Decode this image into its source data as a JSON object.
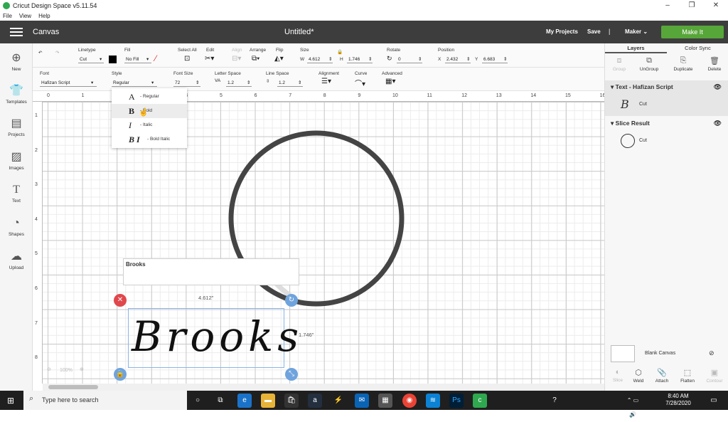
{
  "window": {
    "title": "Cricut Design Space  v5.11.54",
    "menu": [
      "File",
      "View",
      "Help"
    ]
  },
  "header": {
    "section": "Canvas",
    "doc_title": "Untitled*",
    "my_projects": "My Projects",
    "save": "Save",
    "separator": "|",
    "machine": "Maker",
    "make_it": "Make It"
  },
  "leftbar": {
    "items": [
      {
        "label": "New",
        "icon": "plus-circle-icon"
      },
      {
        "label": "Templates",
        "icon": "shirt-icon"
      },
      {
        "label": "Projects",
        "icon": "projects-icon"
      },
      {
        "label": "Images",
        "icon": "image-icon"
      },
      {
        "label": "Text",
        "icon": "text-icon"
      },
      {
        "label": "Shapes",
        "icon": "shapes-icon"
      },
      {
        "label": "Upload",
        "icon": "upload-icon"
      }
    ]
  },
  "toolbar1": {
    "linetype_label": "Linetype",
    "linetype_value": "Cut",
    "fill_label": "Fill",
    "fill_value": "No Fill",
    "select_all": "Select All",
    "edit": "Edit",
    "align": "Align",
    "arrange": "Arrange",
    "flip": "Flip",
    "size_label": "Size",
    "w_label": "W",
    "w_value": "4.612",
    "h_label": "H",
    "h_value": "1.746",
    "rotate_label": "Rotate",
    "rotate_value": "0",
    "position_label": "Position",
    "x_label": "X",
    "x_value": "2.432",
    "y_label": "Y",
    "y_value": "6.683"
  },
  "toolbar2": {
    "font_label": "Font",
    "font_value": "Hafizan Script",
    "style_label": "Style",
    "style_value": "Regular",
    "font_size_label": "Font Size",
    "font_size_value": "72",
    "letter_space_label": "Letter Space",
    "letter_space_value": "1.2",
    "line_space_label": "Line Space",
    "line_space_value": "1.2",
    "alignment_label": "Alignment",
    "curve_label": "Curve",
    "advanced_label": "Advanced"
  },
  "ruler": {
    "top": [
      "0",
      "1",
      "2",
      "3",
      "4",
      "5",
      "6",
      "7",
      "8",
      "9",
      "10",
      "11",
      "12",
      "13",
      "14",
      "15",
      "16"
    ],
    "left": [
      "1",
      "2",
      "3",
      "4",
      "5",
      "6",
      "7",
      "8"
    ]
  },
  "style_dropdown": {
    "items": [
      {
        "glyph": "A",
        "label": "- Regular"
      },
      {
        "glyph": "B",
        "label": "- Bold"
      },
      {
        "glyph": "I",
        "label": "- Italic"
      },
      {
        "glyph": "B I",
        "label": "- Bold Italic"
      }
    ]
  },
  "canvas": {
    "text_edit_value": "Brooks",
    "script_text": "Brooks",
    "width_dim": "4.612\"",
    "height_dim": "1.746\"",
    "zoom": "100%"
  },
  "layers_panel": {
    "tabs": [
      "Layers",
      "Color Sync"
    ],
    "top_tools": [
      "Group",
      "UnGroup",
      "Duplicate",
      "Delete"
    ],
    "groups": [
      {
        "name": "Text - Hafizan Script",
        "item": "Cut"
      },
      {
        "name": "Slice Result",
        "item": "Cut"
      }
    ],
    "blank_canvas": "Blank Canvas",
    "bottom_tools": [
      "Slice",
      "Weld",
      "Attach",
      "Flatten",
      "Contour"
    ]
  },
  "taskbar": {
    "search_placeholder": "Type here to search",
    "time": "8:40 AM",
    "date": "7/28/2020"
  },
  "colors": {
    "header_bg": "#3d3d3d",
    "make_it_green": "#57a639",
    "delete_red": "#e0474c",
    "handle_blue": "#6fa3dd"
  }
}
